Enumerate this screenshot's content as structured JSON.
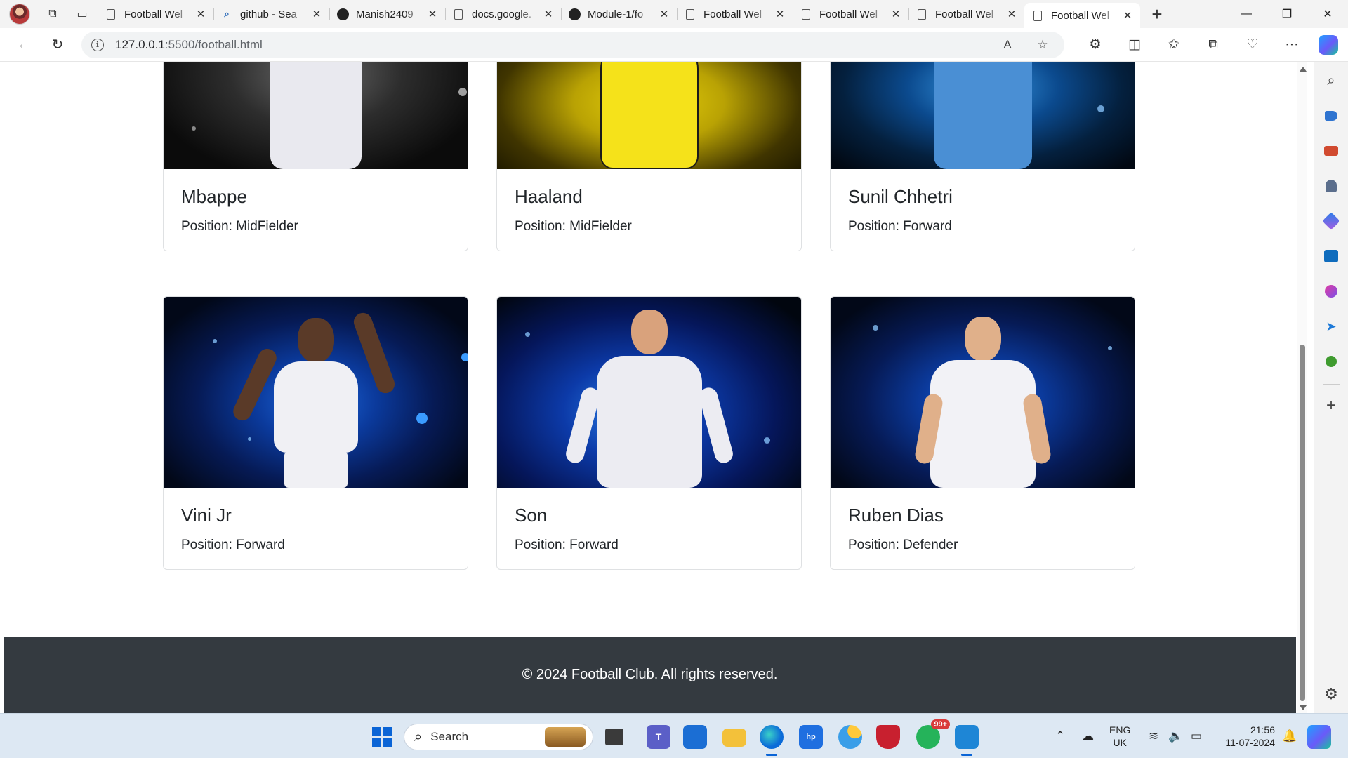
{
  "browser": {
    "tabs": [
      {
        "title": "Football Wel",
        "icon": "document-icon",
        "active": false
      },
      {
        "title": "github - Sea",
        "icon": "search-icon",
        "active": false
      },
      {
        "title": "Manish2409",
        "icon": "github-icon",
        "active": false
      },
      {
        "title": "docs.google.",
        "icon": "document-icon",
        "active": false
      },
      {
        "title": "Module-1/fo",
        "icon": "github-icon",
        "active": false
      },
      {
        "title": "Football Wel",
        "icon": "document-icon",
        "active": false
      },
      {
        "title": "Football Wel",
        "icon": "document-icon",
        "active": false
      },
      {
        "title": "Football Wel",
        "icon": "document-icon",
        "active": false
      },
      {
        "title": "Football Wel",
        "icon": "document-icon",
        "active": true
      }
    ],
    "url_host": "127.0.0.1",
    "url_rest": ":5500/football.html"
  },
  "page": {
    "cards": [
      {
        "name": "Mbappe",
        "position": "Position: MidFielder"
      },
      {
        "name": "Haaland",
        "position": "Position: MidFielder"
      },
      {
        "name": "Sunil Chhetri",
        "position": "Position: Forward"
      },
      {
        "name": "Vini Jr",
        "position": "Position: Forward"
      },
      {
        "name": "Son",
        "position": "Position: Forward"
      },
      {
        "name": "Ruben Dias",
        "position": "Position: Defender"
      }
    ],
    "footer": "© 2024 Football Club. All rights reserved."
  },
  "taskbar": {
    "search_label": "Search",
    "whatsapp_badge": "99+",
    "lang_line1": "ENG",
    "lang_line2": "UK",
    "time": "21:56",
    "date": "11-07-2024"
  },
  "colors": {
    "footer_bg": "#343a40",
    "accent": "#0a64d6"
  }
}
